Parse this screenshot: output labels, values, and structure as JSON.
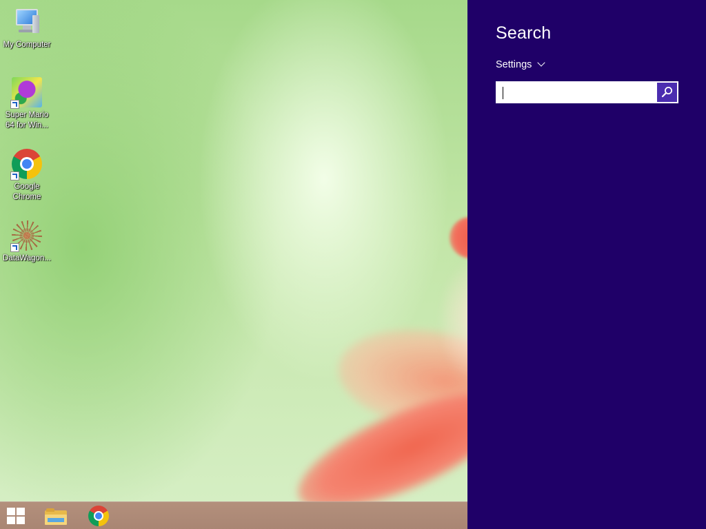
{
  "desktop": {
    "icons": [
      {
        "label": "My Computer",
        "icon": "my-computer-icon"
      },
      {
        "label": "Super Mario 64 for Win...",
        "icon": "super-mario-icon"
      },
      {
        "label": "Google Chrome",
        "icon": "chrome-icon"
      },
      {
        "label": "DataWagon...",
        "icon": "datawagon-icon"
      }
    ]
  },
  "taskbar": {
    "items": [
      {
        "name": "Start",
        "icon": "windows-logo-icon"
      },
      {
        "name": "File Explorer",
        "icon": "folder-icon"
      },
      {
        "name": "Google Chrome",
        "icon": "chrome-icon"
      }
    ]
  },
  "charm": {
    "title": "Search",
    "scope_label": "Settings",
    "search_value": "",
    "background": "#1f0068",
    "search_button_color": "#4b2db0",
    "icons": {
      "scope": "chevron-down-icon",
      "submit": "magnifier-icon"
    }
  }
}
